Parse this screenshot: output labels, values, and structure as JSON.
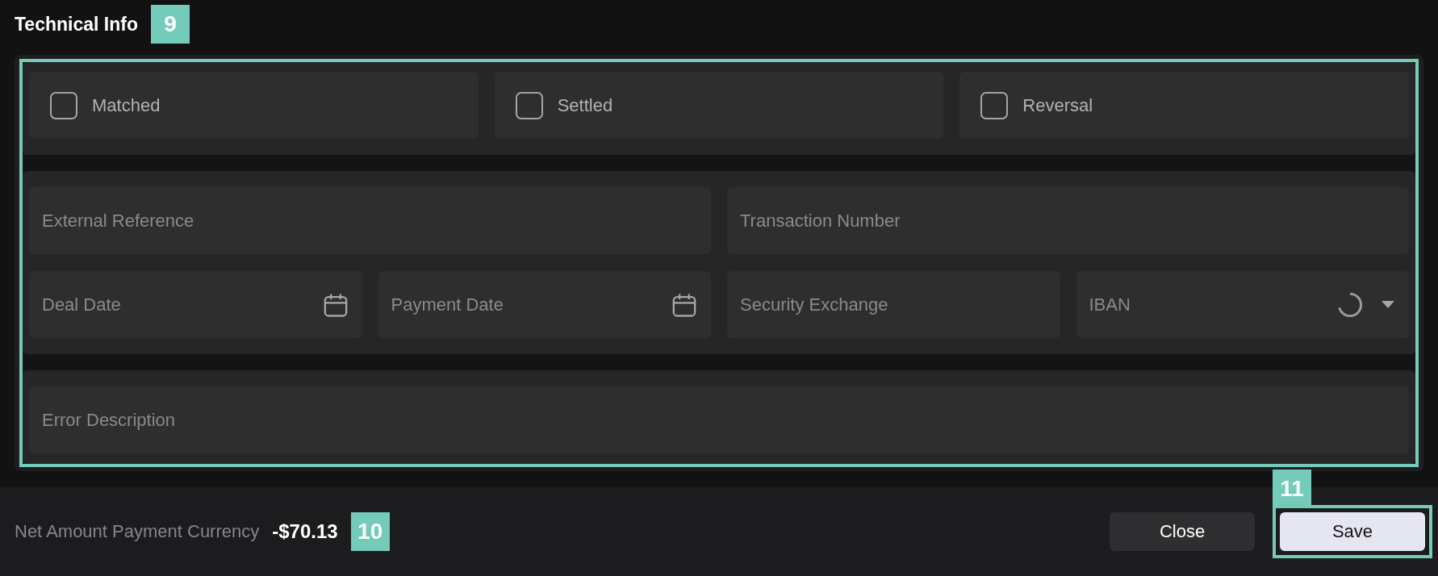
{
  "header": {
    "title": "Technical Info",
    "annotation": "9"
  },
  "checkboxes": [
    {
      "label": "Matched",
      "checked": false
    },
    {
      "label": "Settled",
      "checked": false
    },
    {
      "label": "Reversal",
      "checked": false
    }
  ],
  "field_rows": [
    [
      {
        "placeholder": "External Reference",
        "kind": "text"
      },
      {
        "placeholder": "Transaction Number",
        "kind": "text"
      }
    ],
    [
      {
        "placeholder": "Deal Date",
        "kind": "date"
      },
      {
        "placeholder": "Payment Date",
        "kind": "date"
      },
      {
        "placeholder": "Security Exchange",
        "kind": "text"
      },
      {
        "placeholder": "IBAN",
        "kind": "select",
        "loading": true
      }
    ]
  ],
  "error_field": {
    "placeholder": "Error Description"
  },
  "footer": {
    "label": "Net Amount Payment Currency",
    "amount": "-$70.13",
    "annotation": "10",
    "buttons": [
      {
        "label": "Close",
        "kind": "secondary"
      },
      {
        "label": "Save",
        "kind": "primary",
        "annotation": "11"
      }
    ]
  }
}
